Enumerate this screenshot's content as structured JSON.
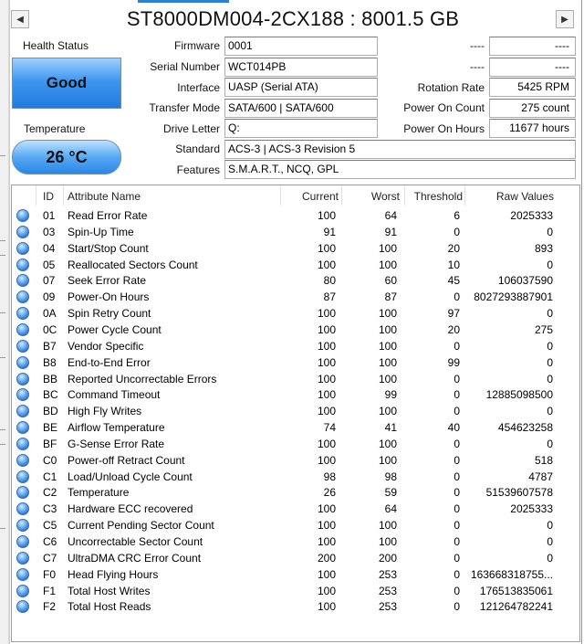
{
  "window": {
    "title": "ST8000DM004-2CX188 : 8001.5 GB",
    "nav_left_glyph": "◀",
    "nav_right_glyph": "▶"
  },
  "health": {
    "label": "Health Status",
    "value": "Good"
  },
  "temperature": {
    "label": "Temperature",
    "value": "26 °C"
  },
  "info": {
    "firmware": {
      "label": "Firmware",
      "value": "0001"
    },
    "serial": {
      "label": "Serial Number",
      "value": "WCT014PB"
    },
    "interface": {
      "label": "Interface",
      "value": "UASP (Serial ATA)"
    },
    "transfer": {
      "label": "Transfer Mode",
      "value": "SATA/600 | SATA/600"
    },
    "drive_letter": {
      "label": "Drive Letter",
      "value": "Q:"
    },
    "standard": {
      "label": "Standard",
      "value": "ACS-3 | ACS-3 Revision 5"
    },
    "features": {
      "label": "Features",
      "value": "S.M.A.R.T., NCQ, GPL"
    }
  },
  "right_info": {
    "blank1": {
      "label": "----",
      "value": "----"
    },
    "blank2": {
      "label": "----",
      "value": "----"
    },
    "rotation": {
      "label": "Rotation Rate",
      "value": "5425 RPM"
    },
    "power_on_count": {
      "label": "Power On Count",
      "value": "275 count"
    },
    "power_on_hours": {
      "label": "Power On Hours",
      "value": "11677 hours"
    }
  },
  "smart_table": {
    "columns": [
      "ID",
      "Attribute Name",
      "Current",
      "Worst",
      "Threshold",
      "Raw Values"
    ],
    "rows": [
      {
        "id": "01",
        "name": "Read Error Rate",
        "current": "100",
        "worst": "64",
        "threshold": "6",
        "raw": "2025333"
      },
      {
        "id": "03",
        "name": "Spin-Up Time",
        "current": "91",
        "worst": "91",
        "threshold": "0",
        "raw": "0"
      },
      {
        "id": "04",
        "name": "Start/Stop Count",
        "current": "100",
        "worst": "100",
        "threshold": "20",
        "raw": "893"
      },
      {
        "id": "05",
        "name": "Reallocated Sectors Count",
        "current": "100",
        "worst": "100",
        "threshold": "10",
        "raw": "0"
      },
      {
        "id": "07",
        "name": "Seek Error Rate",
        "current": "80",
        "worst": "60",
        "threshold": "45",
        "raw": "106037590"
      },
      {
        "id": "09",
        "name": "Power-On Hours",
        "current": "87",
        "worst": "87",
        "threshold": "0",
        "raw": "8027293887901"
      },
      {
        "id": "0A",
        "name": "Spin Retry Count",
        "current": "100",
        "worst": "100",
        "threshold": "97",
        "raw": "0"
      },
      {
        "id": "0C",
        "name": "Power Cycle Count",
        "current": "100",
        "worst": "100",
        "threshold": "20",
        "raw": "275"
      },
      {
        "id": "B7",
        "name": "Vendor Specific",
        "current": "100",
        "worst": "100",
        "threshold": "0",
        "raw": "0"
      },
      {
        "id": "B8",
        "name": "End-to-End Error",
        "current": "100",
        "worst": "100",
        "threshold": "99",
        "raw": "0"
      },
      {
        "id": "BB",
        "name": "Reported Uncorrectable Errors",
        "current": "100",
        "worst": "100",
        "threshold": "0",
        "raw": "0"
      },
      {
        "id": "BC",
        "name": "Command Timeout",
        "current": "100",
        "worst": "99",
        "threshold": "0",
        "raw": "12885098500"
      },
      {
        "id": "BD",
        "name": "High Fly Writes",
        "current": "100",
        "worst": "100",
        "threshold": "0",
        "raw": "0"
      },
      {
        "id": "BE",
        "name": "Airflow Temperature",
        "current": "74",
        "worst": "41",
        "threshold": "40",
        "raw": "454623258"
      },
      {
        "id": "BF",
        "name": "G-Sense Error Rate",
        "current": "100",
        "worst": "100",
        "threshold": "0",
        "raw": "0"
      },
      {
        "id": "C0",
        "name": "Power-off Retract Count",
        "current": "100",
        "worst": "100",
        "threshold": "0",
        "raw": "518"
      },
      {
        "id": "C1",
        "name": "Load/Unload Cycle Count",
        "current": "98",
        "worst": "98",
        "threshold": "0",
        "raw": "4787"
      },
      {
        "id": "C2",
        "name": "Temperature",
        "current": "26",
        "worst": "59",
        "threshold": "0",
        "raw": "51539607578"
      },
      {
        "id": "C3",
        "name": "Hardware ECC recovered",
        "current": "100",
        "worst": "64",
        "threshold": "0",
        "raw": "2025333"
      },
      {
        "id": "C5",
        "name": "Current Pending Sector Count",
        "current": "100",
        "worst": "100",
        "threshold": "0",
        "raw": "0"
      },
      {
        "id": "C6",
        "name": "Uncorrectable Sector Count",
        "current": "100",
        "worst": "100",
        "threshold": "0",
        "raw": "0"
      },
      {
        "id": "C7",
        "name": "UltraDMA CRC Error Count",
        "current": "200",
        "worst": "200",
        "threshold": "0",
        "raw": "0"
      },
      {
        "id": "F0",
        "name": "Head Flying Hours",
        "current": "100",
        "worst": "253",
        "threshold": "0",
        "raw": "163668318755..."
      },
      {
        "id": "F1",
        "name": "Total Host Writes",
        "current": "100",
        "worst": "253",
        "threshold": "0",
        "raw": "176513835061"
      },
      {
        "id": "F2",
        "name": "Total Host Reads",
        "current": "100",
        "worst": "253",
        "threshold": "0",
        "raw": "121264782241"
      }
    ]
  },
  "colors": {
    "status_good": "#3e97ee",
    "accent": "#2f7fd6"
  }
}
